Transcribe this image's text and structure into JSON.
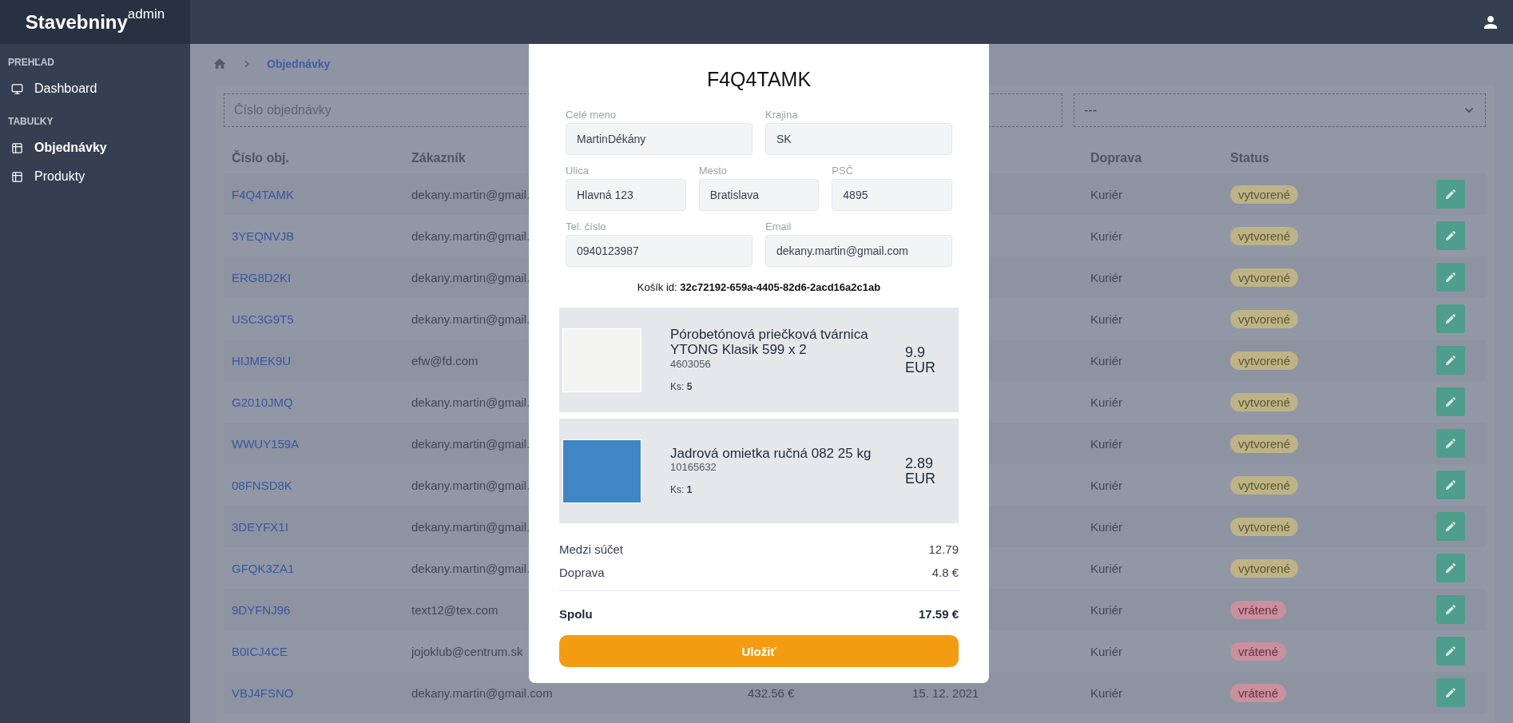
{
  "brand": {
    "name": "Stavebniny",
    "suffix": "admin"
  },
  "sidebar": {
    "sections": [
      {
        "title": "PREHĽAD",
        "items": [
          {
            "label": "Dashboard",
            "selected": false
          }
        ]
      },
      {
        "title": "TABUĽKY",
        "items": [
          {
            "label": "Objednávky",
            "selected": true
          },
          {
            "label": "Produkty",
            "selected": false
          }
        ]
      }
    ]
  },
  "breadcrumb": {
    "current": "Objednávky"
  },
  "filters": {
    "order_search": {
      "placeholder": "Číslo objednávky"
    },
    "status_select": {
      "value": "---"
    }
  },
  "table": {
    "columns": [
      "Číslo obj.",
      "Zákazník",
      "Doprava",
      "Status"
    ],
    "rows": [
      {
        "order": "F4Q4TAMK",
        "customer": "dekany.martin@gmail.",
        "shipping": "Kuriér",
        "status": {
          "label": "vytvorené",
          "kind": "created"
        }
      },
      {
        "order": "3YEQNVJB",
        "customer": "dekany.martin@gmail.",
        "shipping": "Kuriér",
        "status": {
          "label": "vytvorené",
          "kind": "created"
        }
      },
      {
        "order": "ERG8D2KI",
        "customer": "dekany.martin@gmail.",
        "shipping": "Kuriér",
        "status": {
          "label": "vytvorené",
          "kind": "created"
        }
      },
      {
        "order": "USC3G9T5",
        "customer": "dekany.martin@gmail.",
        "shipping": "Kuriér",
        "status": {
          "label": "vytvorené",
          "kind": "created"
        }
      },
      {
        "order": "HIJMEK9U",
        "customer": "efw@fd.com",
        "shipping": "Kuriér",
        "status": {
          "label": "vytvorené",
          "kind": "created"
        }
      },
      {
        "order": "G2010JMQ",
        "customer": "dekany.martin@gmail.",
        "shipping": "Kuriér",
        "status": {
          "label": "vytvorené",
          "kind": "created"
        }
      },
      {
        "order": "WWUY159A",
        "customer": "dekany.martin@gmail.",
        "shipping": "Kuriér",
        "status": {
          "label": "vytvorené",
          "kind": "created"
        }
      },
      {
        "order": "08FNSD8K",
        "customer": "dekany.martin@gmail.",
        "shipping": "Kuriér",
        "status": {
          "label": "vytvorené",
          "kind": "created"
        }
      },
      {
        "order": "3DEYFX1I",
        "customer": "dekany.martin@gmail.",
        "shipping": "Kuriér",
        "status": {
          "label": "vytvorené",
          "kind": "created"
        }
      },
      {
        "order": "GFQK3ZA1",
        "customer": "dekany.martin@gmail.",
        "shipping": "Kuriér",
        "status": {
          "label": "vytvorené",
          "kind": "created"
        }
      },
      {
        "order": "9DYFNJ96",
        "customer": "text12@tex.com",
        "shipping": "Kuriér",
        "status": {
          "label": "vrátené",
          "kind": "returned"
        }
      },
      {
        "order": "B0ICJ4CE",
        "customer": "jojoklub@centrum.sk",
        "shipping": "Kuriér",
        "status": {
          "label": "vrátené",
          "kind": "returned"
        }
      },
      {
        "order": "VBJ4FSNO",
        "customer": "dekany.martin@gmail.com",
        "column_3": "432.56 €",
        "column_4": "15. 12. 2021",
        "shipping": "Kuriér",
        "status": {
          "label": "vrátené",
          "kind": "returned"
        }
      }
    ]
  },
  "modal": {
    "title": "F4Q4TAMK",
    "field_rows": [
      {
        "fields": [
          {
            "label": "Celé meno",
            "value": "MartinDékány"
          },
          {
            "label": "Krajina",
            "value": "SK"
          }
        ]
      },
      {
        "fields": [
          {
            "label": "Ulica",
            "value": "Hlavná 123"
          },
          {
            "label": "Mesto",
            "value": "Bratislava"
          },
          {
            "label": "PSČ",
            "value": "4895"
          }
        ]
      },
      {
        "fields": [
          {
            "label": "Tel. číslo",
            "value": "0940123987"
          },
          {
            "label": "Email",
            "value": "dekany.martin@gmail.com"
          }
        ]
      }
    ],
    "cart_id": "Košík id: **32c72192-659a-4405-82d6-2acd16a2c1ab**",
    "items": [
      {
        "name": "Pórobetónová priečková tvárnica YTONG Klasik 599 x 2",
        "code": "4603056",
        "quantity": "Ks: **5**",
        "price": "9.9 EUR"
      },
      {
        "name": "Jadrová omietka ručná 082 25 kg",
        "code": "10165632",
        "quantity": "Ks: **1**",
        "price": "2.89 EUR"
      }
    ],
    "summary": [
      {
        "label": "Medzi súčet",
        "value": "12.79"
      },
      {
        "label": "Doprava",
        "value": "4.8 €"
      }
    ],
    "total": {
      "label": "Spolu",
      "value": "17.59 €"
    },
    "save_button": "Uložiť"
  }
}
